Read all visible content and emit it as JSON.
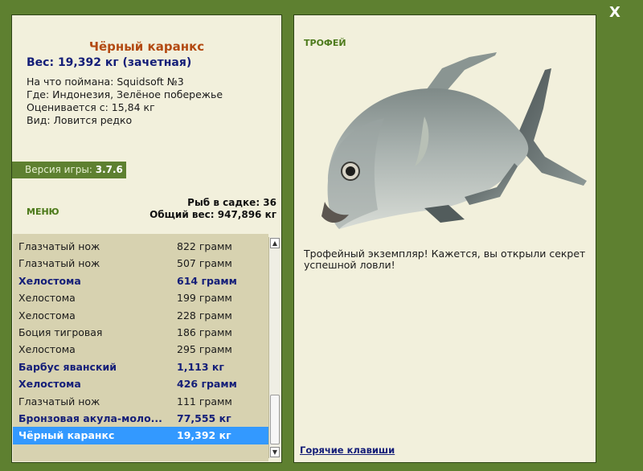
{
  "close_label": "X",
  "fish": {
    "title": "Чёрный каранкс",
    "weight_line": "Вес: 19,392 кг (зачетная)",
    "caught_with": "На что поймана: Squidsoft №3",
    "location": "Где: Индонезия, Зелёное побережье",
    "valued_from": "Оценивается с: 15,84 кг",
    "species_rarity": "Вид: Ловится редко"
  },
  "version": {
    "label": "Версия игры:",
    "value": "3.7.6"
  },
  "menu_label": "МЕНЮ",
  "cage": {
    "count_line": "Рыб в садке: 36",
    "total_line": "Общий вес: 947,896 кг"
  },
  "fish_list": [
    {
      "name": "Глазчатый нож",
      "weight": "822 грамм",
      "bold": false,
      "selected": false
    },
    {
      "name": "Глазчатый нож",
      "weight": "507 грамм",
      "bold": false,
      "selected": false
    },
    {
      "name": "Хелостома",
      "weight": "614 грамм",
      "bold": true,
      "selected": false
    },
    {
      "name": "Хелостома",
      "weight": "199 грамм",
      "bold": false,
      "selected": false
    },
    {
      "name": "Хелостома",
      "weight": "228 грамм",
      "bold": false,
      "selected": false
    },
    {
      "name": "Боция тигровая",
      "weight": "186 грамм",
      "bold": false,
      "selected": false
    },
    {
      "name": "Хелостома",
      "weight": "295 грамм",
      "bold": false,
      "selected": false
    },
    {
      "name": "Барбус яванский",
      "weight": "1,113 кг",
      "bold": true,
      "selected": false
    },
    {
      "name": "Хелостома",
      "weight": "426 грамм",
      "bold": true,
      "selected": false
    },
    {
      "name": "Глазчатый нож",
      "weight": "111 грамм",
      "bold": false,
      "selected": false
    },
    {
      "name": "Бронзовая акула-моло...",
      "weight": "77,555 кг",
      "bold": true,
      "selected": false
    },
    {
      "name": "Чёрный каранкс",
      "weight": "19,392 кг",
      "bold": false,
      "selected": true
    }
  ],
  "trophy": {
    "label": "ТРОФЕЙ",
    "text": "Трофейный экземпляр! Кажется, вы открыли секрет успешной ловли!"
  },
  "hotkeys_label": "Горячие клавиши",
  "colors": {
    "frame_green": "#5e8030",
    "panel_bg": "#f2f0dc",
    "title_orange": "#b34a12",
    "navy": "#141e78",
    "selection_blue": "#3399ff",
    "list_bg": "#d7d2b0"
  }
}
